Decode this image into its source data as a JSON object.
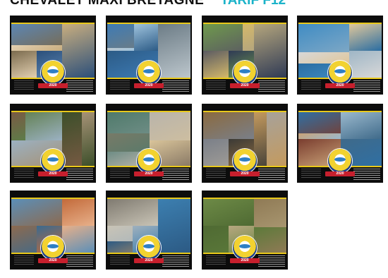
{
  "header": {
    "title": "CHEVALET MAXI BRETAGNE",
    "tarif": "TARIF F12",
    "tarif_color": "#1bb3c9"
  },
  "badge": {
    "year": "2020"
  },
  "cards": [
    {
      "name": "card-1",
      "palette": [
        "#5b86b4",
        "#c9ae7f",
        "#7a6a4d",
        "#2b4f7a",
        "#e3d0b1"
      ]
    },
    {
      "name": "card-2",
      "palette": [
        "#3d7bb5",
        "#9fc3dd",
        "#6c7c86",
        "#2c5b86",
        "#bcc6cc"
      ]
    },
    {
      "name": "card-3",
      "palette": [
        "#6f9a4c",
        "#b5a67d",
        "#5b5b62",
        "#2f3a55",
        "#d4b86a"
      ]
    },
    {
      "name": "card-4",
      "palette": [
        "#3f8cc4",
        "#e0c79b",
        "#9fb6c6",
        "#2a6da2",
        "#d8d8d8"
      ]
    },
    {
      "name": "card-5",
      "palette": [
        "#5d7c48",
        "#3c4f2a",
        "#9bb1c2",
        "#7a5a44",
        "#a69276"
      ]
    },
    {
      "name": "card-6",
      "palette": [
        "#8a7a66",
        "#b9b4ab",
        "#4f7a6b",
        "#d9c49a",
        "#6d8c84"
      ]
    },
    {
      "name": "card-7",
      "palette": [
        "#8b6a3f",
        "#c49a5e",
        "#7a7f88",
        "#3b3a36",
        "#a7a29a"
      ]
    },
    {
      "name": "card-8",
      "palette": [
        "#2f6fa3",
        "#9bb9cd",
        "#7a3d2f",
        "#3f6a8a",
        "#c9a277"
      ]
    },
    {
      "name": "card-9",
      "palette": [
        "#5b8fb8",
        "#c36a3a",
        "#8c6a4f",
        "#e7b08a",
        "#3a6a8f"
      ]
    },
    {
      "name": "card-10",
      "palette": [
        "#7f7a70",
        "#3c7fb0",
        "#c9c4b6",
        "#2c5a84",
        "#9fb0bd"
      ]
    },
    {
      "name": "card-11",
      "palette": [
        "#6d8a46",
        "#8f7a55",
        "#4f6a33",
        "#b7a780",
        "#5c7a3a"
      ]
    }
  ]
}
